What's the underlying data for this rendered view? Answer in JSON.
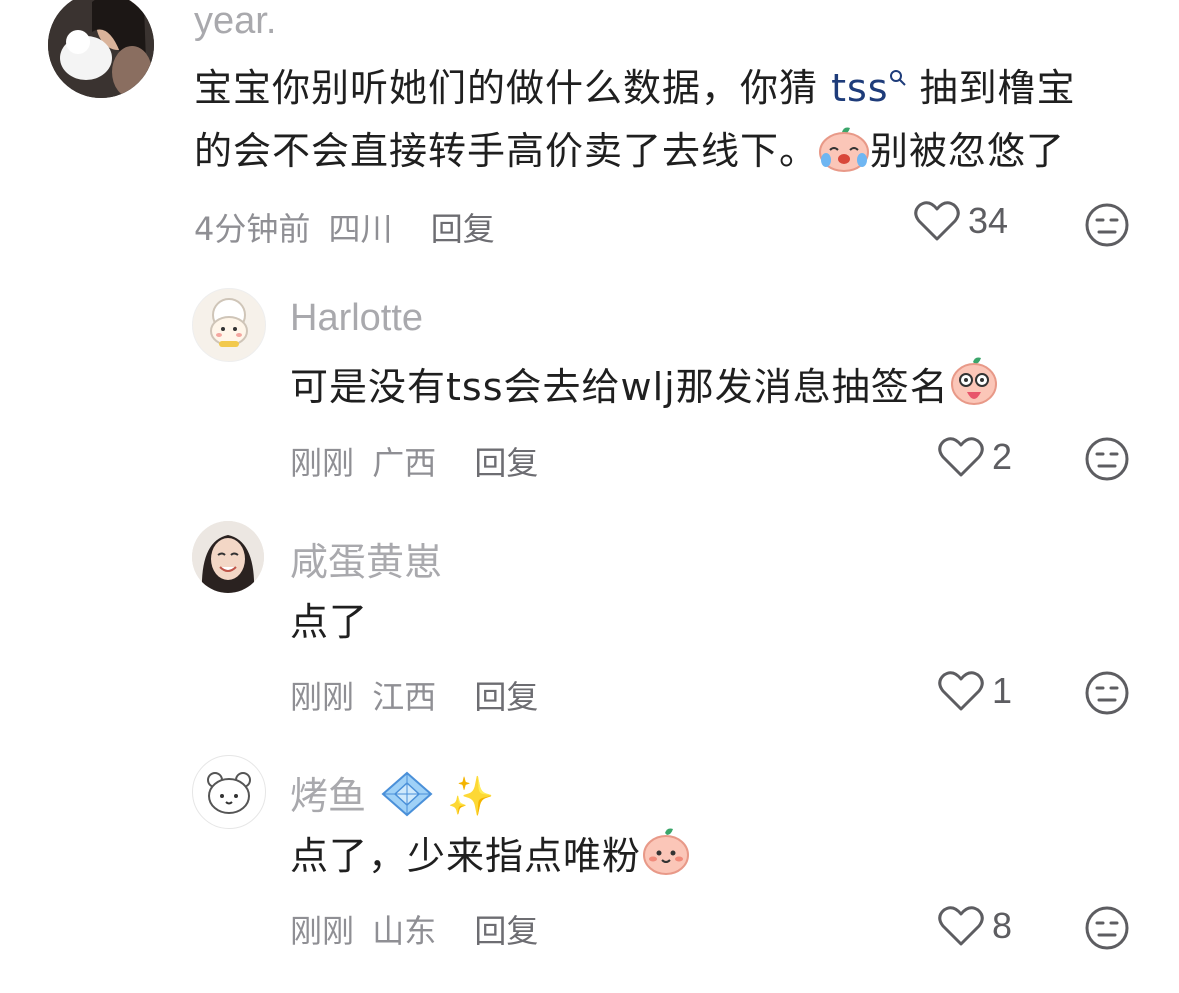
{
  "colors": {
    "username": "#a9a9ad",
    "text": "#1f1f1f",
    "meta": "#8f8f94",
    "hashtag": "#1e3c7a"
  },
  "comments": [
    {
      "username": "year.",
      "content_line1_before": "宝宝你别听她们的做什么数据，你猜 ",
      "hashtag": "tss",
      "content_line1_after": " 抽到橹宝",
      "content_line2_before": "的会不会直接转手高价卖了去线下。",
      "content_line2_after": "别被忽悠了",
      "time": "4分钟前",
      "location": "四川",
      "reply_label": "回复",
      "likes": "34"
    },
    {
      "username": "Harlotte",
      "content": "可是没有tss会去给wlj那发消息抽签名",
      "time": "刚刚",
      "location": "广西",
      "reply_label": "回复",
      "likes": "2"
    },
    {
      "username": "咸蛋黄崽",
      "content": "点了",
      "time": "刚刚",
      "location": "江西",
      "reply_label": "回复",
      "likes": "1"
    },
    {
      "username": "烤鱼",
      "username_emoji": "✨",
      "content": "点了，少来指点唯粉",
      "time": "刚刚",
      "location": "山东",
      "reply_label": "回复",
      "likes": "8"
    }
  ]
}
